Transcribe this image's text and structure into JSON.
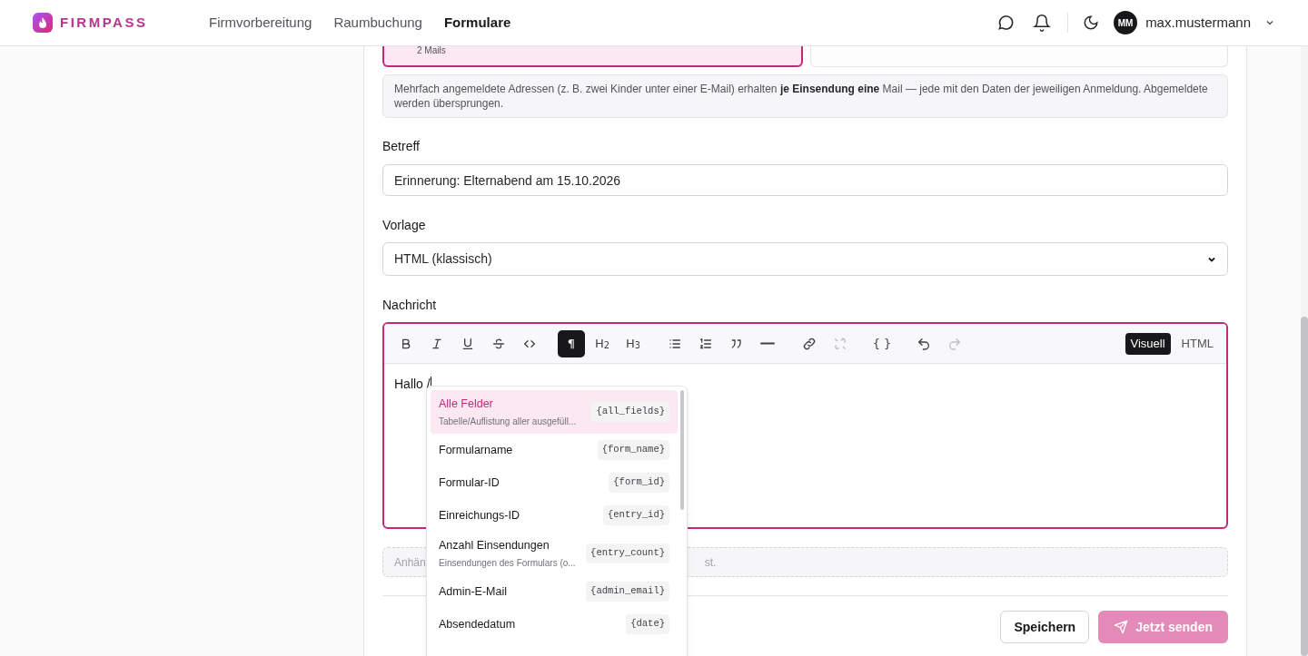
{
  "header": {
    "brand": "FIRMPASS",
    "nav": [
      {
        "label": "Firmvorbereitung",
        "selected": false
      },
      {
        "label": "Raumbuchung",
        "selected": false
      },
      {
        "label": "Formulare",
        "selected": true
      }
    ],
    "user": {
      "initials": "MM",
      "name": "max.mustermann"
    }
  },
  "recipient_card": {
    "count": "2 Mails",
    "selected": true
  },
  "info_note": "Mehrfach angemeldete Adressen (z. B. zwei Kinder unter einer E-Mail) erhalten **je Einsendung eine** Mail — jede mit den Daten der jeweiligen Anmeldung. Abgemeldete werden übersprungen.",
  "subject": {
    "label": "Betreff",
    "value": "Erinnerung: Elternabend am 15.10.2026"
  },
  "template": {
    "label": "Vorlage",
    "value": "HTML (klassisch)"
  },
  "message": {
    "label": "Nachricht",
    "toolbar": [
      [
        {
          "kind": "bold",
          "selected": false,
          "disabled": false
        },
        {
          "kind": "italic",
          "selected": false,
          "disabled": false
        },
        {
          "kind": "underline",
          "selected": false,
          "disabled": false
        },
        {
          "kind": "strike",
          "selected": false,
          "disabled": false
        },
        {
          "kind": "code",
          "selected": false,
          "disabled": false
        }
      ],
      [
        {
          "kind": "text",
          "label": "¶",
          "selected": true,
          "disabled": false
        },
        {
          "kind": "text",
          "label": "H$_{2}$",
          "selected": false,
          "disabled": false
        },
        {
          "kind": "text",
          "label": "H$_{3}$",
          "selected": false,
          "disabled": false
        }
      ],
      [
        {
          "kind": "bullets",
          "selected": false,
          "disabled": false
        },
        {
          "kind": "numbers",
          "selected": false,
          "disabled": false
        },
        {
          "kind": "quote",
          "selected": false,
          "disabled": false
        },
        {
          "kind": "rule",
          "selected": false,
          "disabled": false
        }
      ],
      [
        {
          "kind": "link",
          "selected": false,
          "disabled": false
        },
        {
          "kind": "unlink",
          "selected": false,
          "disabled": true
        }
      ],
      [
        {
          "kind": "text",
          "label": "{ }",
          "selected": false,
          "disabled": false
        }
      ],
      [
        {
          "kind": "undo",
          "selected": false,
          "disabled": false
        },
        {
          "kind": "redo",
          "selected": false,
          "disabled": true
        }
      ]
    ],
    "modes": [
      {
        "label": "Visuell",
        "selected": true
      },
      {
        "label": "HTML",
        "selected": false
      }
    ],
    "content": "Hallo /"
  },
  "attachment_note": {
    "start": "Anhän",
    "end": "st."
  },
  "suggestions": [
    {
      "title": "Alle Felder",
      "description": "Tabelle/Auflistung aller ausgefüll...",
      "token": "{all_fields}",
      "selected": true
    },
    {
      "title": "Formularname",
      "token": "{form_name}",
      "selected": false
    },
    {
      "title": "Formular-ID",
      "token": "{form_id}",
      "selected": false
    },
    {
      "title": "Einreichungs-ID",
      "token": "{entry_id}",
      "selected": false
    },
    {
      "title": "Anzahl Einsendungen",
      "description": "Einsendungen des Formulars (o...",
      "token": "{entry_count}",
      "selected": false
    },
    {
      "title": "Admin-E-Mail",
      "token": "{admin_email}",
      "selected": false
    },
    {
      "title": "Absendedatum",
      "token": "{date}",
      "selected": false
    }
  ],
  "actions": [
    {
      "kind": "secondary",
      "label": "Speichern",
      "disabled": false
    },
    {
      "kind": "send",
      "label": "Jetzt senden",
      "disabled": true
    }
  ]
}
